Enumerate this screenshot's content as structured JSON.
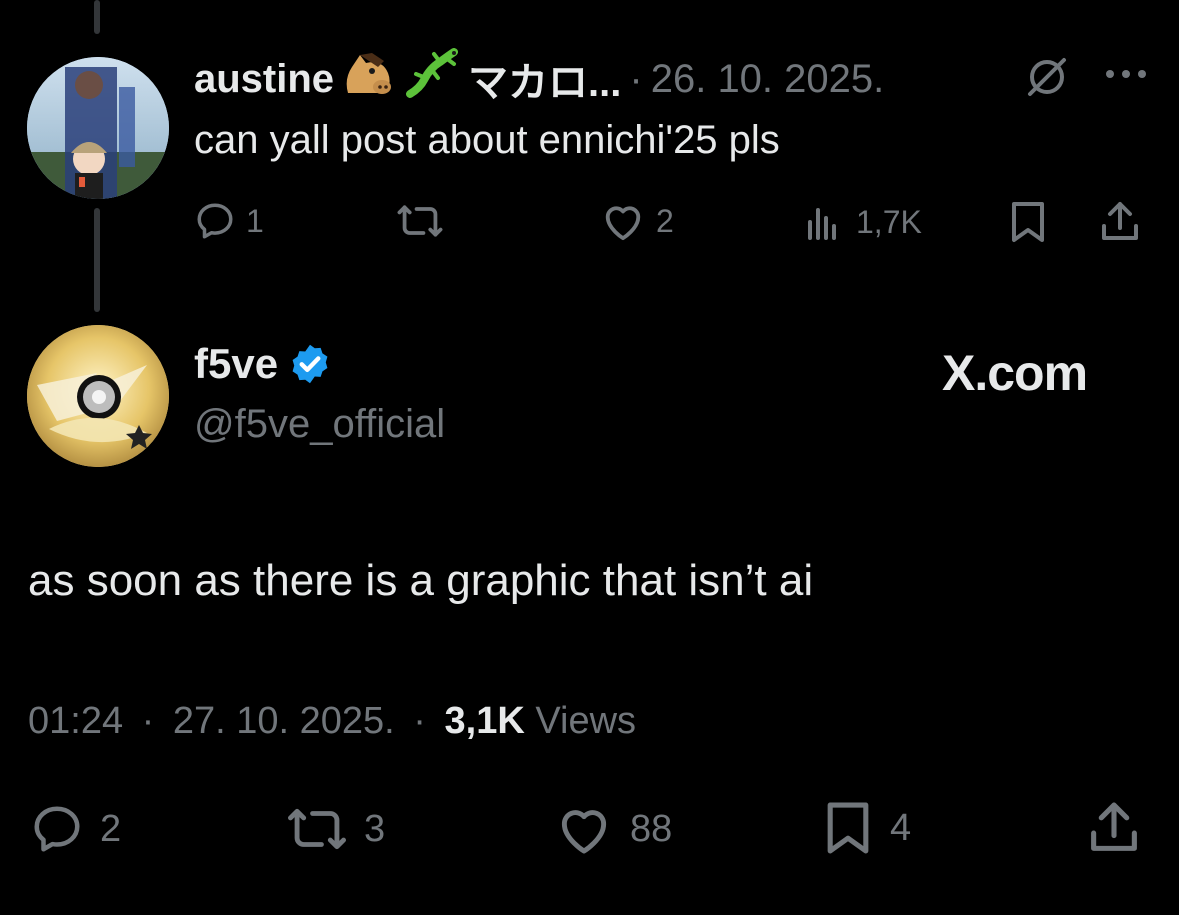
{
  "reply": {
    "display_name": "austine",
    "name_suffix": "マカロ...",
    "date": "26. 10. 2025.",
    "text": "can yall post about ennichi'25 pls",
    "stats": {
      "replies": "1",
      "reposts": "",
      "likes": "2",
      "views": "1,7K"
    }
  },
  "post": {
    "display_name": "f5ve",
    "handle": "@f5ve_official",
    "badge": "X.com",
    "text": "as soon as there is a graphic that isn’t ai",
    "time": "01:24",
    "date": "27. 10. 2025.",
    "views_count": "3,1K",
    "views_label": "Views",
    "stats": {
      "replies": "2",
      "reposts": "3",
      "likes": "88",
      "bookmarks": "4"
    }
  },
  "separator": "·",
  "colors": {
    "background": "#000000",
    "text_primary": "#e7e9ea",
    "text_secondary": "#71767b",
    "verified_blue": "#1d9bf0"
  }
}
